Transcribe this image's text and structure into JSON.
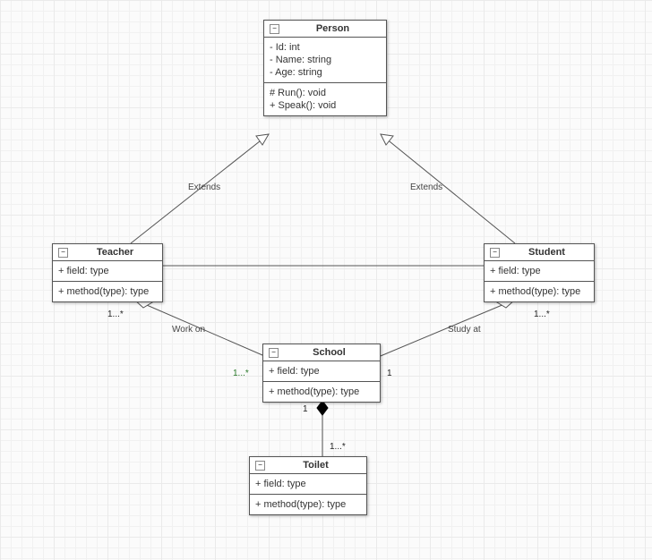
{
  "classes": {
    "person": {
      "name": "Person",
      "attrs": [
        "- Id: int",
        "- Name: string",
        "- Age: string"
      ],
      "ops": [
        "# Run(): void",
        "+ Speak(): void"
      ]
    },
    "teacher": {
      "name": "Teacher",
      "attrs": [
        "+ field: type"
      ],
      "ops": [
        "+ method(type): type"
      ]
    },
    "student": {
      "name": "Student",
      "attrs": [
        "+ field: type"
      ],
      "ops": [
        "+ method(type): type"
      ]
    },
    "school": {
      "name": "School",
      "attrs": [
        "+ field: type"
      ],
      "ops": [
        "+ method(type): type"
      ]
    },
    "toilet": {
      "name": "Toilet",
      "attrs": [
        "+ field: type"
      ],
      "ops": [
        "+ method(type): type"
      ]
    }
  },
  "labels": {
    "extends_left": "Extends",
    "extends_right": "Extends",
    "work_on": "Work on",
    "study_at": "Study at"
  },
  "mult": {
    "teacher_aggr": "1...*",
    "student_aggr": "1...*",
    "school_left": "1...*",
    "school_right": "1",
    "school_bottom": "1",
    "toilet_top": "1...*"
  },
  "collapse_glyph": "−",
  "chart_data": {
    "type": "uml_class_diagram",
    "classes": [
      {
        "id": "Person",
        "attributes": [
          "- Id: int",
          "- Name: string",
          "- Age: string"
        ],
        "operations": [
          "# Run(): void",
          "+ Speak(): void"
        ]
      },
      {
        "id": "Teacher",
        "attributes": [
          "+ field: type"
        ],
        "operations": [
          "+ method(type): type"
        ]
      },
      {
        "id": "Student",
        "attributes": [
          "+ field: type"
        ],
        "operations": [
          "+ method(type): type"
        ]
      },
      {
        "id": "School",
        "attributes": [
          "+ field: type"
        ],
        "operations": [
          "+ method(type): type"
        ]
      },
      {
        "id": "Toilet",
        "attributes": [
          "+ field: type"
        ],
        "operations": [
          "+ method(type): type"
        ]
      }
    ],
    "relationships": [
      {
        "from": "Teacher",
        "to": "Person",
        "type": "generalization",
        "label": "Extends"
      },
      {
        "from": "Student",
        "to": "Person",
        "type": "generalization",
        "label": "Extends"
      },
      {
        "from": "Teacher",
        "to": "Student",
        "type": "association"
      },
      {
        "from": "Teacher",
        "to": "School",
        "type": "aggregation",
        "label": "Work on",
        "from_mult": "1...*",
        "to_mult": "1...*"
      },
      {
        "from": "Student",
        "to": "School",
        "type": "aggregation",
        "label": "Study at",
        "from_mult": "1...*",
        "to_mult": "1"
      },
      {
        "from": "School",
        "to": "Toilet",
        "type": "composition",
        "from_mult": "1",
        "to_mult": "1...*"
      }
    ]
  }
}
